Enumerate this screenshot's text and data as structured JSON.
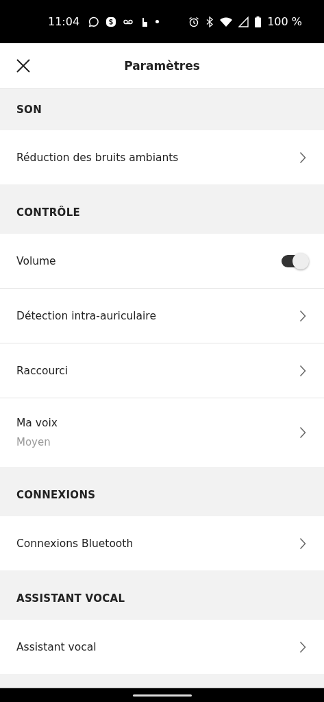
{
  "status_bar": {
    "time": "11:04",
    "battery": "100 %"
  },
  "header": {
    "title": "Paramètres"
  },
  "sections": [
    {
      "title": "SON",
      "rows": [
        {
          "kind": "link",
          "label": "Réduction des bruits ambiants"
        }
      ]
    },
    {
      "title": "CONTRÔLE",
      "rows": [
        {
          "kind": "toggle",
          "label": "Volume",
          "on": true
        },
        {
          "kind": "link",
          "label": "Détection intra-auriculaire"
        },
        {
          "kind": "link",
          "label": "Raccourci"
        },
        {
          "kind": "link",
          "label": "Ma voix",
          "subtitle": "Moyen"
        }
      ]
    },
    {
      "title": "CONNEXIONS",
      "rows": [
        {
          "kind": "link",
          "label": "Connexions Bluetooth"
        }
      ]
    },
    {
      "title": "ASSISTANT VOCAL",
      "rows": [
        {
          "kind": "link",
          "label": "Assistant vocal"
        }
      ]
    }
  ]
}
